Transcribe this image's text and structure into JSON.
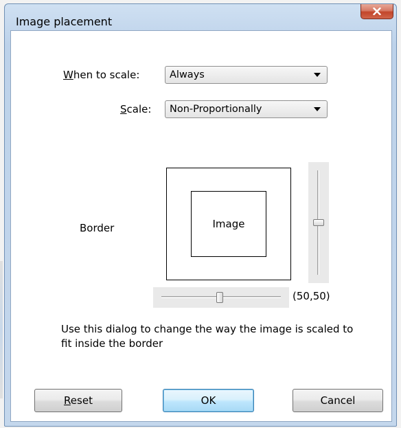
{
  "window": {
    "title": "Image placement",
    "close_icon": "close-icon"
  },
  "form": {
    "when_to_scale": {
      "label_accel": "W",
      "label_rest": "hen to scale:",
      "value": "Always"
    },
    "scale": {
      "label_accel": "S",
      "label_rest": "cale:",
      "value": "Non-Proportionally"
    }
  },
  "preview": {
    "border_label": "Border",
    "image_label": "Image",
    "position_readout": "(50,50)",
    "horizontal_slider_value": 50,
    "vertical_slider_value": 50
  },
  "description": "Use this dialog to change the way the image is scaled to fit inside the border",
  "buttons": {
    "reset_accel": "R",
    "reset_rest": "eset",
    "ok": "OK",
    "cancel": "Cancel"
  },
  "colors": {
    "default_button_border": "#3c7fb1",
    "close_button": "#c2462b"
  }
}
